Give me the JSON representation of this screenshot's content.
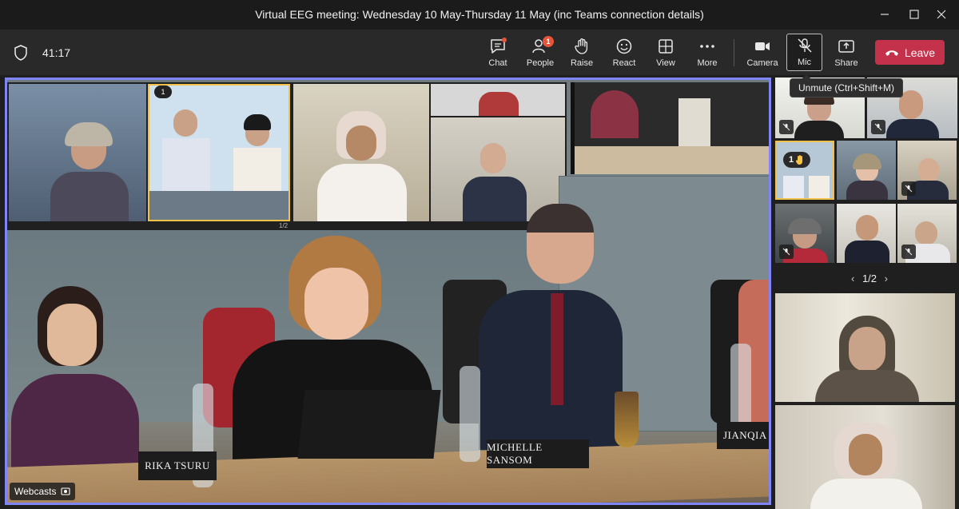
{
  "window": {
    "title": "Virtual EEG meeting: Wednesday 10 May-Thursday 11 May (inc Teams connection details)"
  },
  "toolbar": {
    "timer": "41:17",
    "chat": {
      "label": "Chat",
      "icon": "chat-icon"
    },
    "people": {
      "label": "People",
      "badge": "1",
      "icon": "people-icon"
    },
    "raise": {
      "label": "Raise",
      "icon": "hand-icon"
    },
    "react": {
      "label": "React",
      "icon": "smiley-icon"
    },
    "view": {
      "label": "View",
      "icon": "grid-icon"
    },
    "more": {
      "label": "More",
      "icon": "ellipsis-icon"
    },
    "camera": {
      "label": "Camera",
      "icon": "camera-icon"
    },
    "mic": {
      "label": "Mic",
      "icon": "mic-off-icon"
    },
    "share": {
      "label": "Share",
      "icon": "share-icon"
    },
    "leave": {
      "label": "Leave",
      "color": "#c4314b"
    }
  },
  "tooltip": {
    "text": "Unmute (Ctrl+Shift+M)"
  },
  "stage": {
    "webcasts_label": "Webcasts",
    "nameplates": {
      "left": "RIKA TSURU",
      "center": "MICHELLE SANSOM",
      "right": "JIANQIA"
    },
    "screen": {
      "page_indicator": "1/2",
      "hand_badge": "1"
    },
    "active_border_color": "#7f85f5"
  },
  "gallery": {
    "pager": "1/2",
    "hand_badge": "1",
    "raised_hand_color": "#f6c343"
  }
}
